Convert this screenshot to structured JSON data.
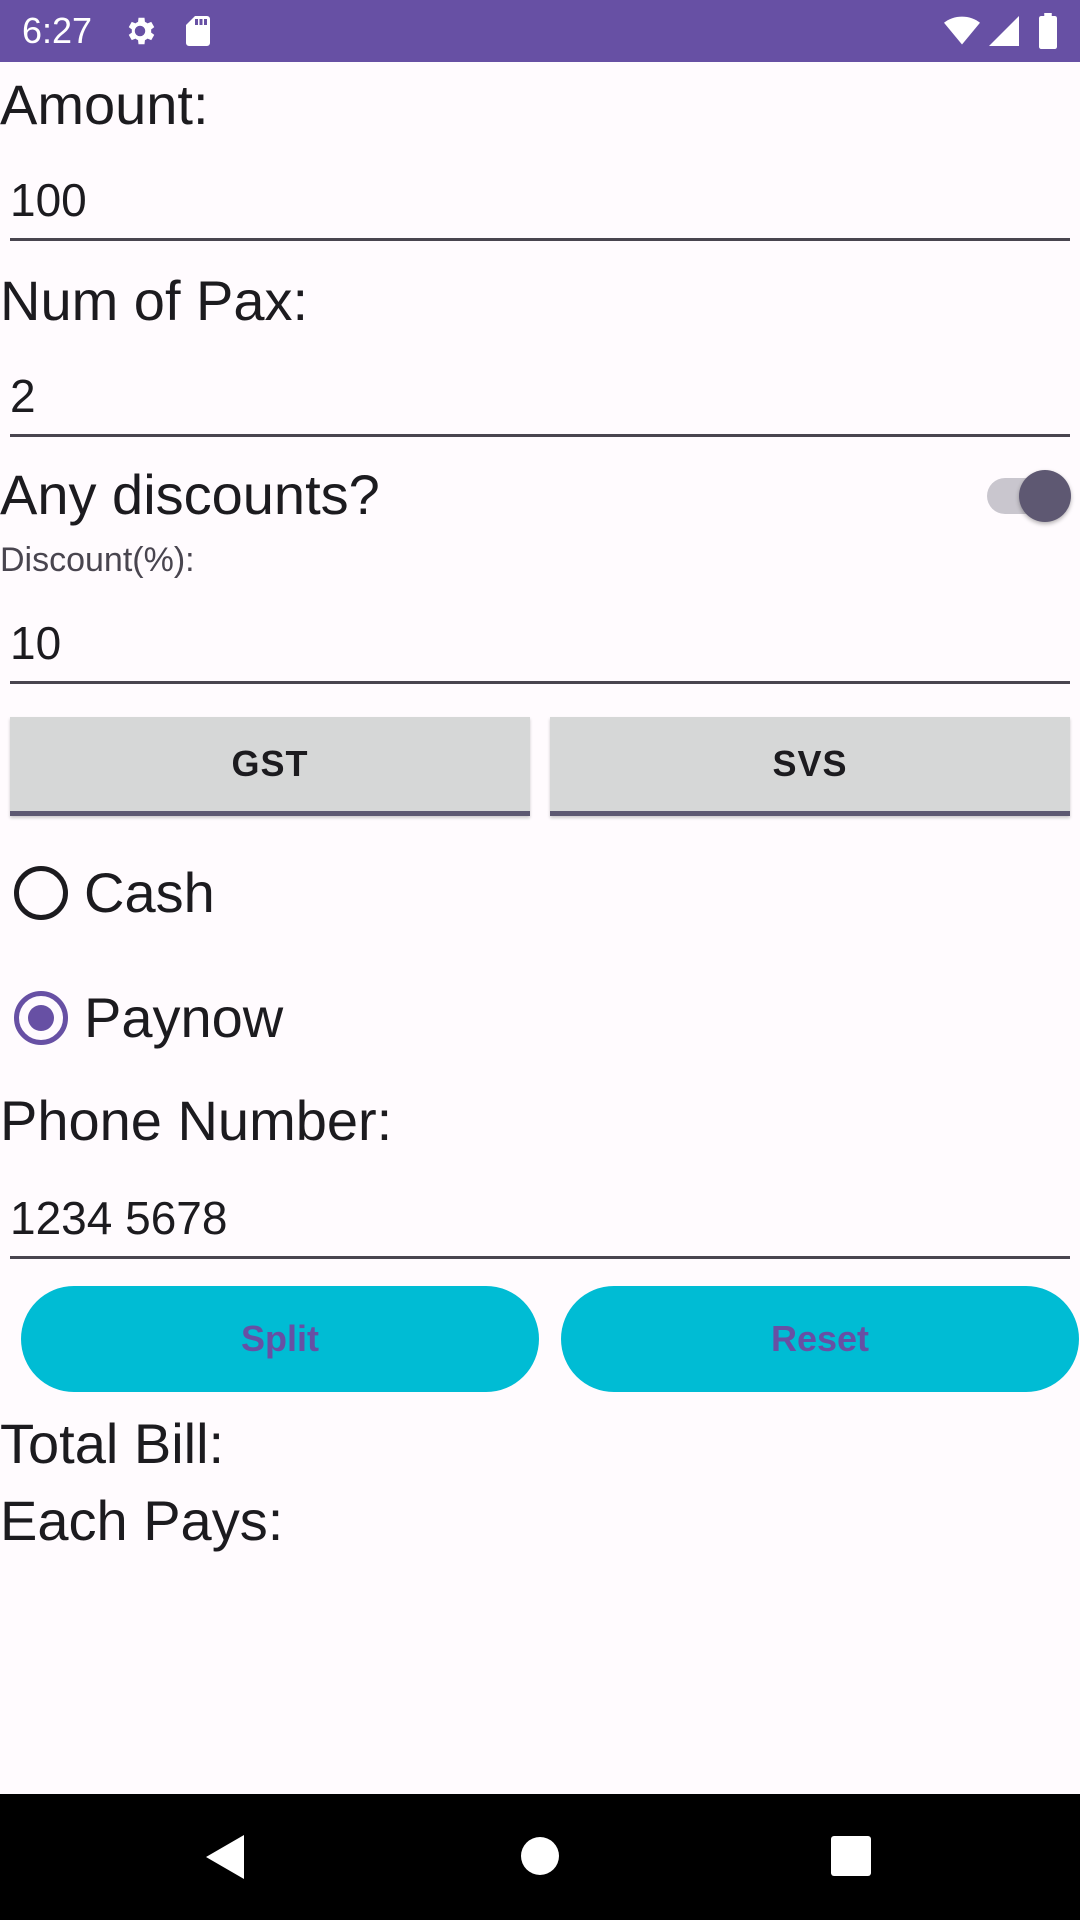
{
  "status_bar": {
    "time": "6:27",
    "left_icons": [
      "gear-icon",
      "sd-card-icon"
    ],
    "right_icons": [
      "wifi-icon",
      "cell-signal-icon",
      "battery-icon"
    ],
    "color": "#6750A4"
  },
  "form": {
    "amount": {
      "label": "Amount:",
      "value": "100"
    },
    "pax": {
      "label": "Num of Pax:",
      "value": "2"
    },
    "discount_toggle": {
      "label": "Any discounts?",
      "checked": true
    },
    "discount": {
      "label": "Discount(%):",
      "value": "10"
    },
    "gst_button": "GST",
    "svs_button": "SVS",
    "payment": {
      "options": [
        {
          "label": "Cash",
          "checked": false
        },
        {
          "label": "Paynow",
          "checked": true
        }
      ]
    },
    "phone": {
      "label": "Phone Number:",
      "value": "1234 5678"
    },
    "split_button": "Split",
    "reset_button": "Reset"
  },
  "results": {
    "total_label": "Total Bill:",
    "each_label": "Each Pays:"
  },
  "nav_bar": {
    "icons": [
      "back-icon",
      "home-icon",
      "recents-icon"
    ]
  },
  "colors": {
    "accent": "#6750A4",
    "button_cyan": "#00BCD4",
    "background": "#FFFBFE"
  }
}
